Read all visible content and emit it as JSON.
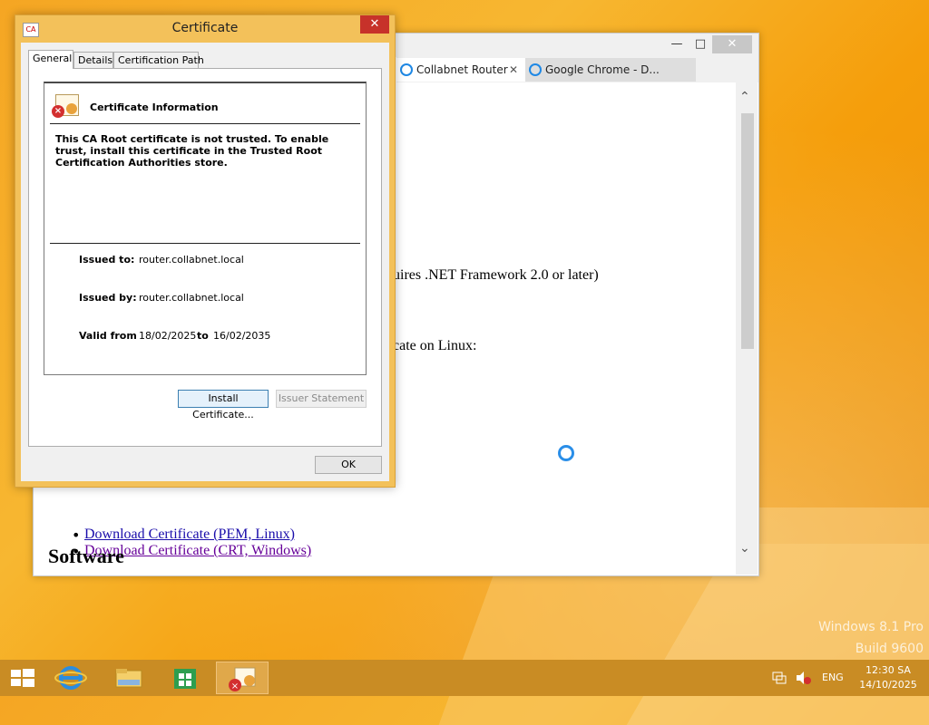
{
  "desktop": {
    "watermark_line1": "Windows 8.1 Pro",
    "watermark_line2": "Build 9600"
  },
  "browser": {
    "tabs": [
      {
        "label": "Collabnet Router"
      },
      {
        "label": "Google Chrome - D..."
      }
    ],
    "content": {
      "text1": "uires .NET Framework 2.0 or later)",
      "text2": "cate on Linux:",
      "link1": "Download Certificate (PEM, Linux)",
      "link2": "Download Certificate (CRT, Windows)",
      "heading": "Software"
    }
  },
  "dialog": {
    "title": "Certificate",
    "icon_label": "CA",
    "tabs": [
      "General",
      "Details",
      "Certification Path"
    ],
    "info_title": "Certificate Information",
    "warning": "This CA Root certificate is not trusted. To enable trust, install this certificate in the Trusted Root Certification Authorities store.",
    "issued_to_label": "Issued to:",
    "issued_to": "router.collabnet.local",
    "issued_by_label": "Issued by:",
    "issued_by": "router.collabnet.local",
    "valid_from_label": "Valid from",
    "valid_from": "18/02/2025",
    "to_label": "to",
    "valid_to": "16/02/2035",
    "install_button": "Install Certificate...",
    "issuer_button": "Issuer Statement",
    "ok_button": "OK"
  },
  "taskbar": {
    "lang": "ENG",
    "time": "12:30 SA",
    "date": "14/10/2025"
  }
}
